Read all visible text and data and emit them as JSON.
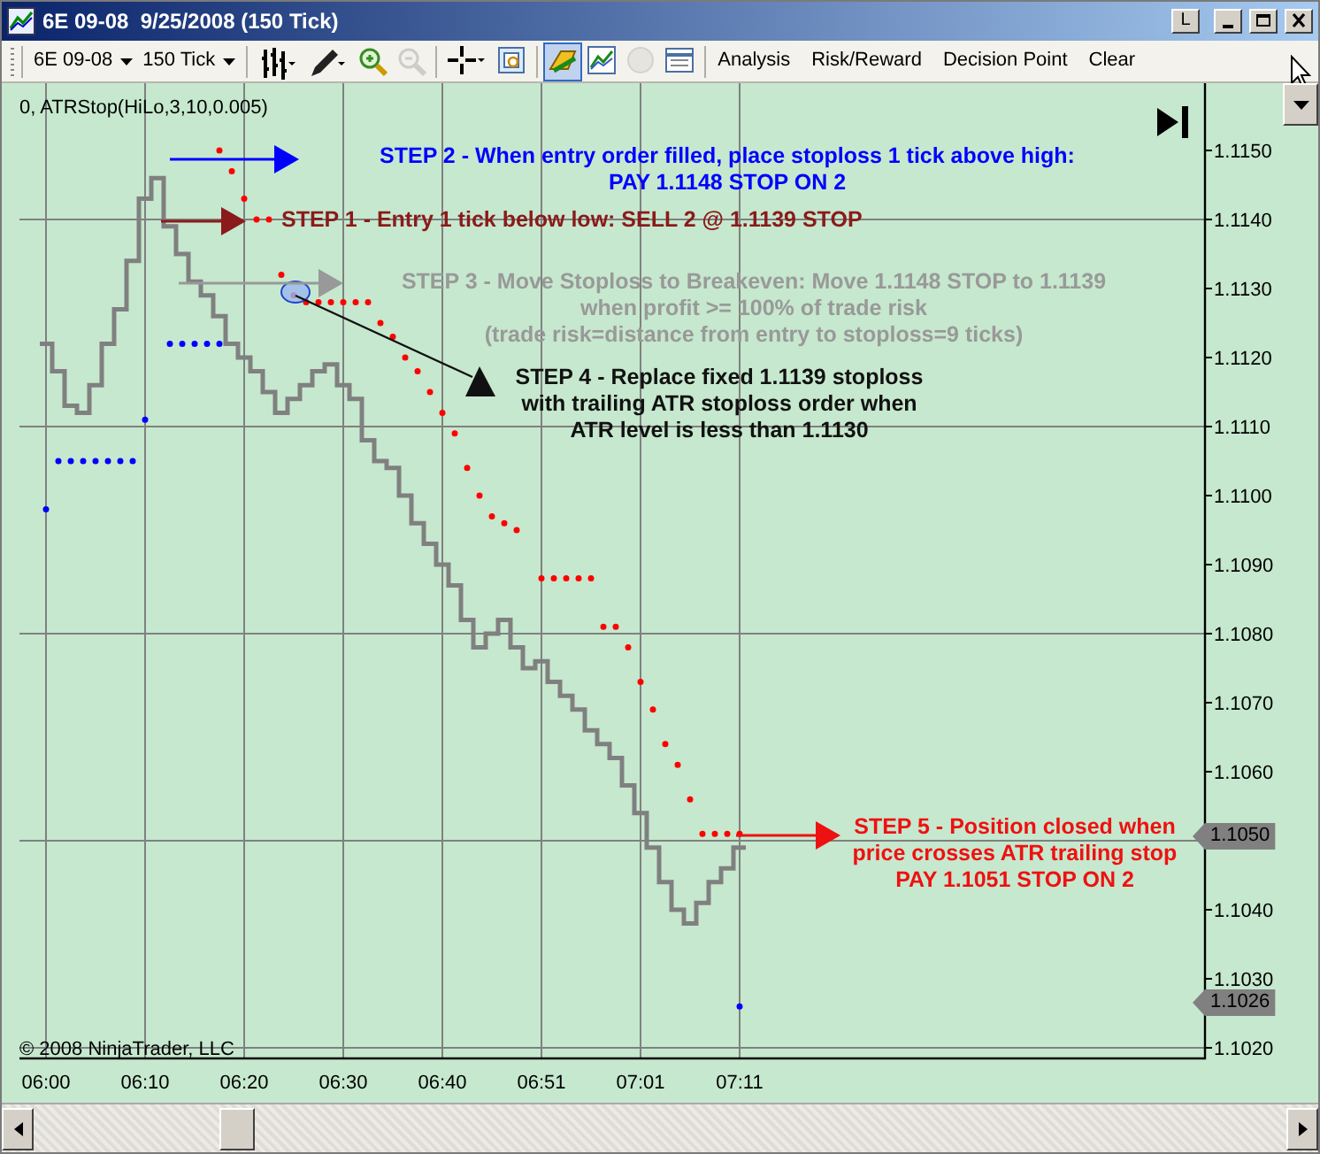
{
  "window": {
    "title": "6E 09-08  9/25/2008 (150 Tick)",
    "title_button": "L"
  },
  "toolbar": {
    "instrument": "6E 09-08",
    "period": "150 Tick",
    "tools": [
      {
        "kind": "bars",
        "selected": false,
        "disabled": false
      },
      {
        "kind": "pencil",
        "selected": false,
        "disabled": false
      },
      {
        "kind": "zoom-in",
        "selected": false,
        "disabled": false
      },
      {
        "kind": "zoom-out",
        "selected": false,
        "disabled": true
      },
      {
        "kind": "crosshair",
        "selected": false,
        "disabled": false
      },
      {
        "kind": "properties",
        "selected": false,
        "disabled": false
      },
      {
        "kind": "trader",
        "selected": true,
        "disabled": false
      },
      {
        "kind": "indicator",
        "selected": false,
        "disabled": false
      },
      {
        "kind": "circle",
        "selected": false,
        "disabled": true
      },
      {
        "kind": "table",
        "selected": false,
        "disabled": false
      }
    ],
    "buttons": [
      "Analysis",
      "Risk/Reward",
      "Decision Point",
      "Clear"
    ]
  },
  "chart": {
    "indicator_label": "0, ATRStop(HiLo,3,10,0.005)",
    "copyright": "© 2008 NinjaTrader, LLC",
    "price_markers": [
      "1.1050",
      "1.1026"
    ],
    "annotations": [
      {
        "kind": "step",
        "color": "#0000ff",
        "lines": [
          "STEP 2 - When entry order filled, place stoploss 1 tick above high:",
          "PAY 1.1148 STOP ON 2"
        ]
      },
      {
        "kind": "step",
        "color": "#8b1a1a",
        "lines": [
          "STEP 1 - Entry 1 tick below low: SELL 2 @ 1.1139 STOP"
        ]
      },
      {
        "kind": "step",
        "color": "#999999",
        "lines": [
          "STEP 3 - Move Stoploss to Breakeven: Move 1.1148 STOP to 1.1139",
          "when profit >= 100% of trade risk",
          "(trade risk=distance from entry to stoploss=9 ticks)"
        ]
      },
      {
        "kind": "step",
        "color": "#111111",
        "lines": [
          "STEP 4 - Replace fixed 1.1139 stoploss",
          "with trailing ATR stoploss order when",
          "ATR level is less than 1.1130"
        ]
      },
      {
        "kind": "step",
        "color": "#ee1111",
        "lines": [
          "STEP 5 - Position closed when",
          "price crosses ATR trailing stop",
          "PAY 1.1051 STOP ON 2"
        ]
      }
    ],
    "price_axis_labels": [
      "1.1150",
      "1.1140",
      "1.1130",
      "1.1120",
      "1.1110",
      "1.1100",
      "1.1090",
      "1.1080",
      "1.1070",
      "1.1060"
    ],
    "price_axis_labels_below_marker": [
      "1.1040",
      "1.1030",
      "1.1020"
    ],
    "time_axis_labels": [
      "06:00",
      "06:10",
      "06:20",
      "06:30",
      "06:40",
      "06:51",
      "07:01",
      "07:11"
    ]
  }
}
